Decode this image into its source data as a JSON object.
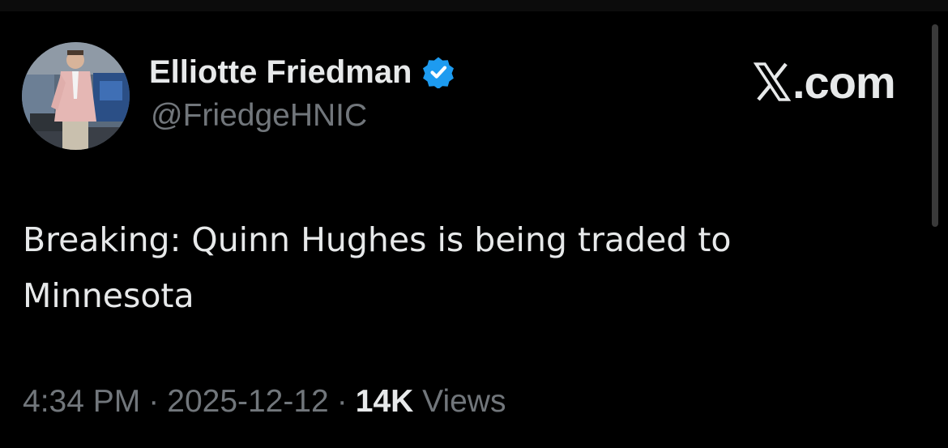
{
  "author": {
    "name": "Elliotte Friedman",
    "handle": "@FriedgeHNIC",
    "verified_icon": "verified-badge-icon",
    "verified_color": "#1d9bf0"
  },
  "brand": {
    "logo_icon": "x-logo-icon",
    "text": ".com"
  },
  "tweet": {
    "text": "Breaking: Quinn Hughes is being traded to Minnesota"
  },
  "meta": {
    "time": "4:34 PM",
    "separator": "·",
    "date": "2025-12-12",
    "views_count": "14K",
    "views_label": "Views"
  },
  "colors": {
    "background": "#000000",
    "primary_text": "#e7e9ea",
    "secondary_text": "#71767b"
  }
}
